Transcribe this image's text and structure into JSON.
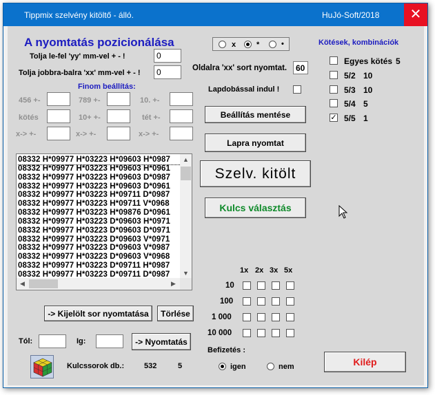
{
  "window": {
    "title": "Tippmix szelvény kitöltő - álló.",
    "brand": "HuJó-Soft/2018",
    "close_glyph": "✕"
  },
  "header": {
    "title": "A nyomtatás pozicionálása"
  },
  "position": {
    "vertical_label": "Tolja le-fel 'yy' mm-vel + - !",
    "vertical_value": "0",
    "horizontal_label": "Tolja jobbra-balra 'xx' mm-vel + - !",
    "horizontal_value": "0"
  },
  "fine": {
    "title": "Finom beállítás:",
    "labels": [
      "456 +-",
      "789 +-",
      "10. +-",
      "kötés",
      "10+ +-",
      "tét +-",
      "x->  +-",
      "x->  +-",
      "x->  +-"
    ],
    "values": [
      "",
      "",
      "",
      "",
      "",
      "",
      "",
      "",
      ""
    ]
  },
  "mode_radio": {
    "options": [
      "x",
      "*",
      "•"
    ],
    "selected": 1
  },
  "settings": {
    "rows_label": "Oldalra 'xx' sort nyomtat.",
    "rows_value": "60",
    "lapdob_label": "Lapdobással indul !",
    "lapdob_checked": false
  },
  "buttons": {
    "save": "Beállítás mentése",
    "print_page": "Lapra nyomtat",
    "fill_ticket": "Szelv. kitölt",
    "key_select": "Kulcs választás",
    "print_selected": "-> Kijelölt sor nyomtatása",
    "delete": "Törlése",
    "print": "-> Nyomtatás",
    "exit": "Kilép"
  },
  "combinations": {
    "title": "Kötések, kombinációk",
    "items": [
      {
        "label": "Egyes kötés",
        "count": "5",
        "checked": false
      },
      {
        "label": "5/2",
        "count": "10",
        "checked": false
      },
      {
        "label": "5/3",
        "count": "10",
        "checked": false
      },
      {
        "label": "5/4",
        "count": "5",
        "checked": false
      },
      {
        "label": "5/5",
        "count": "1",
        "checked": true
      }
    ]
  },
  "list": {
    "rows": [
      "08332 H*09977 H*03223 H*09603 H*0987",
      "08332 H*09977 H*03223 H*09603 H*0961",
      "08332 H*09977 H*03223 H*09603 D*0987",
      "08332 H*09977 H*03223 H*09603 D*0961",
      "08332 H*09977 H*03223 H*09711 D*0987",
      "08332 H*09977 H*03223 H*09711 V*0968",
      "08332 H*09977 H*03223 H*09876 D*0961",
      "08332 H*09977 H*03223 D*09603 H*0971",
      "08332 H*09977 H*03223 D*09603 D*0971",
      "08332 H*09977 H*03223 D*09603 V*0971",
      "08332 H*09977 H*03223 D*09603 V*0987",
      "08332 H*09977 H*03223 D*09603 V*0968",
      "08332 H*09977 H*03223 D*09711 H*0987",
      "08332 H*09977 H*03223 D*09711 D*0987"
    ],
    "selected_index": 0
  },
  "stakes": {
    "columns": [
      "1x",
      "2x",
      "3x",
      "5x"
    ],
    "rows": [
      "10",
      "100",
      "1 000",
      "10 000"
    ]
  },
  "payment": {
    "label": "Befizetés :",
    "options": [
      "igen",
      "nem"
    ],
    "selected": 0
  },
  "range": {
    "from_label": "Tól:",
    "to_label": "Ig:",
    "from_value": "",
    "to_value": ""
  },
  "keys": {
    "label": "Kulcssorok db.:",
    "count": "532",
    "second": "5"
  },
  "colors": {
    "titlebar": "#0b72cc",
    "heading_blue": "#1c1cc0",
    "green_button": "#0f8a2a",
    "red_button": "#e01c1c"
  }
}
